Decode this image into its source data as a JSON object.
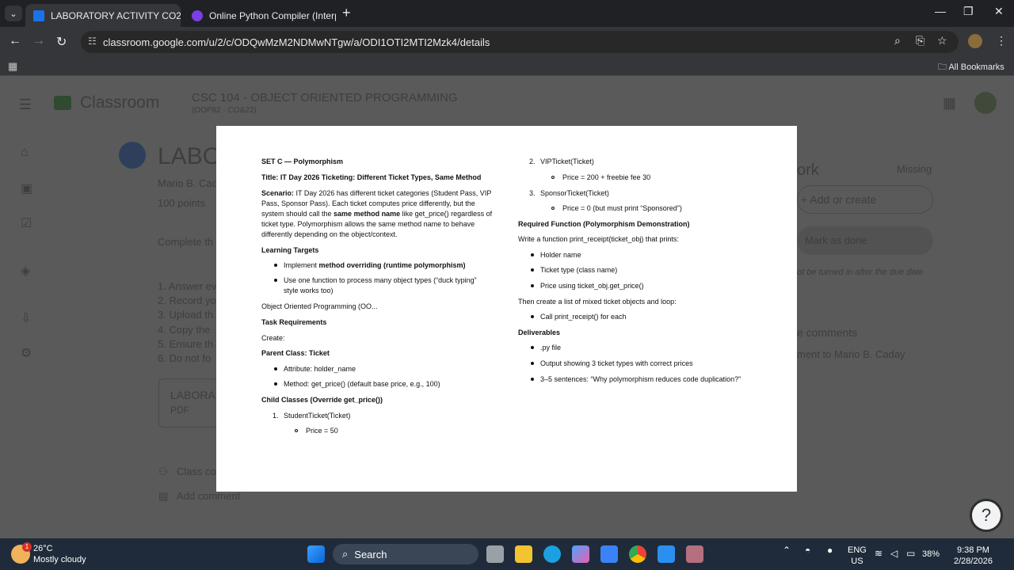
{
  "browser": {
    "tabs": [
      {
        "title": "LABORATORY ACTIVITY CO2&C",
        "active": true
      },
      {
        "title": "Online Python Compiler (Interp",
        "active": false
      }
    ],
    "url": "classroom.google.com/u/2/c/ODQwMzM2NDMwNTgw/a/ODI1OTI2MTI2Mzk4/details",
    "bookmarks_label": "All Bookmarks"
  },
  "classroom": {
    "app_name": "Classroom",
    "course_title": "CSC 104 - OBJECT ORIENTED PROGRAMMING",
    "course_sub": "(OOP82 - CO&22)",
    "assignment_title": "LABO",
    "author": "Mario B. Cad",
    "points": "100 points",
    "complete_prefix": "Complete th",
    "list_items": [
      "1. Answer ev",
      "2. Record yo",
      "3. Upload th",
      "4. Copy the",
      "5. Ensure th",
      "6. Do not fo"
    ],
    "attachment_title": "LABORA",
    "attachment_type": "PDF",
    "class_comments": "Class co",
    "add_comment": "Add comment",
    "your_work": "ork",
    "status": "Missing",
    "add_or_create": "+ Add or create",
    "mark_done": "Mark as done",
    "late_note": "ot be turned in after the due date",
    "private_comments": "e comments",
    "comment_to": "ment to Mario B. Caday"
  },
  "document": {
    "left": {
      "set_heading": "SET C — Polymorphism",
      "title": "Title: IT Day 2026 Ticketing: Different Ticket Types, Same Method",
      "scenario_label": "Scenario:",
      "scenario_l1": " IT Day 2026 has different ticket categories (Student Pass, VIP",
      "scenario_l2": "Pass, Sponsor Pass). Each ticket computes price differently, but the",
      "scenario_l3a": "system should call the ",
      "scenario_l3b": "same method name",
      "scenario_l3c": " like get_price() regardless of",
      "scenario_l4": "ticket type. Polymorphism allows the same method name to behave",
      "scenario_l5": "differently depending on the object/context.",
      "learning_targets": "Learning Targets",
      "lt1a": "Implement ",
      "lt1b": "method overriding (runtime polymorphism)",
      "lt2_l1": "Use one function to process many object types (“duck typing”",
      "lt2_l2": "style works too)",
      "oop_line": "Object Oriented Programming (OO...",
      "task_req": "Task Requirements",
      "create": "Create:",
      "parent_class": "Parent Class: Ticket",
      "attr": "Attribute: holder_name",
      "method": "Method: get_price() (default base price, e.g., 100)",
      "child_classes": "Child Classes (Override get_price())",
      "student_num": "1.",
      "student": "StudentTicket(Ticket)",
      "student_price": "Price = 50"
    },
    "right": {
      "vip_num": "2.",
      "vip": "VIPTicket(Ticket)",
      "vip_price": "Price = 200 + freebie fee 30",
      "sponsor_num": "3.",
      "sponsor": "SponsorTicket(Ticket)",
      "sponsor_price": "Price = 0 (but must print “Sponsored”)",
      "req_func": "Required Function (Polymorphism Demonstration)",
      "write_func": "Write a function print_receipt(ticket_obj) that prints:",
      "p1": "Holder name",
      "p2": "Ticket type (class name)",
      "p3": "Price using ticket_obj.get_price()",
      "then": "Then create a list of mixed ticket objects and loop:",
      "call": "Call print_receipt() for each",
      "deliverables": "Deliverables",
      "d1": ".py file",
      "d2": "Output showing 3 ticket types with correct prices",
      "d3": "3–5 sentences: “Why polymorphism reduces code duplication?”"
    }
  },
  "taskbar": {
    "weather_temp": "26°C",
    "weather_desc": "Mostly cloudy",
    "weather_badge": "1",
    "search": "Search",
    "lang1": "ENG",
    "lang2": "US",
    "battery": "38%",
    "time": "9:38 PM",
    "date": "2/28/2026"
  },
  "colors": {
    "accent": "#1a73e8",
    "classroom_green": "#1e8e3e",
    "taskbar": "#1f2b3a"
  }
}
